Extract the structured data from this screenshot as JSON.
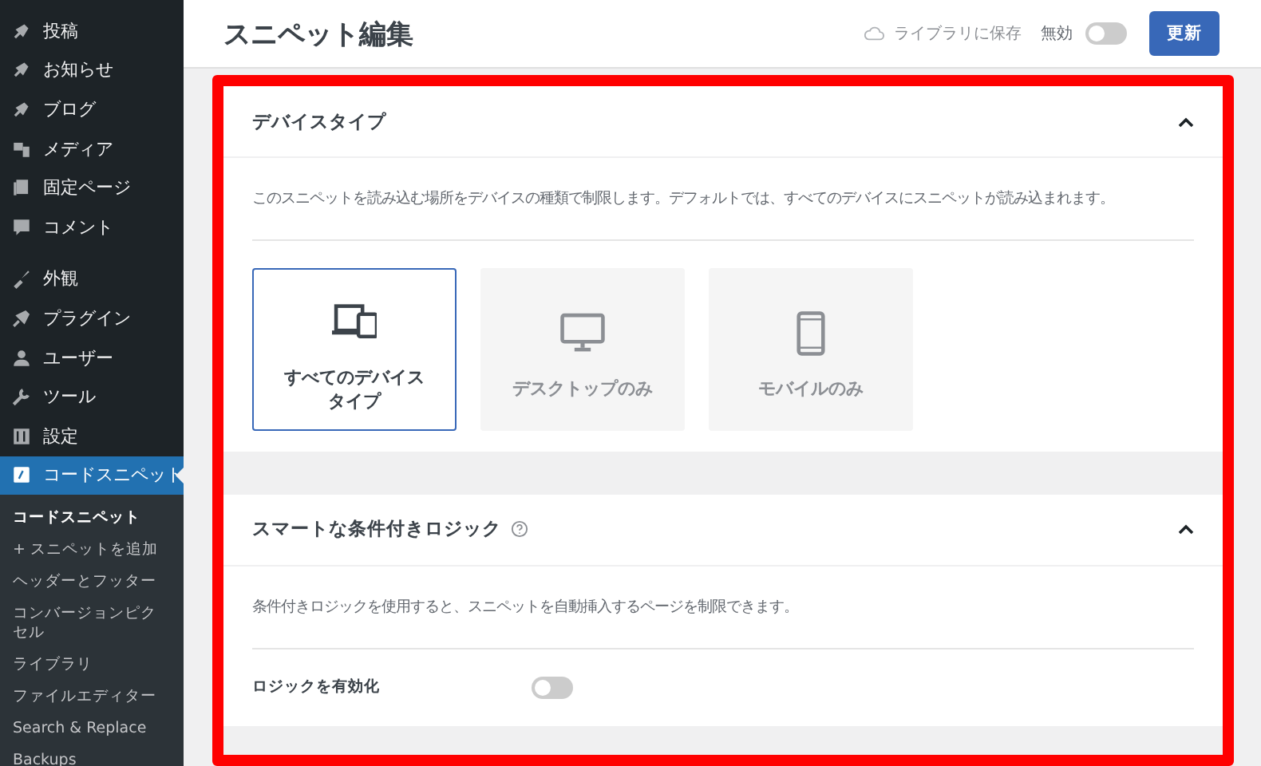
{
  "sidebar": {
    "items": [
      {
        "label": "投稿",
        "selected": false
      },
      {
        "label": "お知らせ",
        "selected": false
      },
      {
        "label": "ブログ",
        "selected": false
      },
      {
        "label": "メディア",
        "selected": false
      },
      {
        "label": "固定ページ",
        "selected": false
      },
      {
        "label": "コメント",
        "selected": false
      },
      {
        "label": "外観",
        "selected": false
      },
      {
        "label": "プラグイン",
        "selected": false
      },
      {
        "label": "ユーザー",
        "selected": false
      },
      {
        "label": "ツール",
        "selected": false
      },
      {
        "label": "設定",
        "selected": false
      },
      {
        "label": "コードスニペット",
        "selected": true
      }
    ],
    "submenu": [
      {
        "label": "コードスニペット",
        "selected": true
      },
      {
        "label": "+ スニペットを追加",
        "selected": false
      },
      {
        "label": "ヘッダーとフッター",
        "selected": false
      },
      {
        "label": "コンバージョンピクセル",
        "selected": false
      },
      {
        "label": "ライブラリ",
        "selected": false
      },
      {
        "label": "ファイルエディター",
        "selected": false
      },
      {
        "label": "Search & Replace",
        "selected": false
      },
      {
        "label": "Backups",
        "selected": false
      }
    ]
  },
  "header": {
    "title": "スニペット編集",
    "save_to_library": "ライブラリに保存",
    "status_label": "無効",
    "active_toggle": {
      "on": false
    },
    "update_button": "更新"
  },
  "panel": {
    "highlighted": true,
    "sections": [
      {
        "kind": "device",
        "title": "デバイスタイプ",
        "expanded": true,
        "description": "このスニペットを読み込む場所をデバイスの種類で制限します。デフォルトでは、すべてのデバイスにスニペットが読み込まれます。",
        "options": [
          {
            "label": "すべてのデバイスタイプ",
            "selected": true
          },
          {
            "label": "デスクトップのみ",
            "selected": false
          },
          {
            "label": "モバイルのみ",
            "selected": false
          }
        ]
      },
      {
        "kind": "logic",
        "title": "スマートな条件付きロジック",
        "expanded": true,
        "description": "条件付きロジックを使用すると、スニペットを自動挿入するページを制限できます。",
        "toggle_label": "ロジックを有効化",
        "toggle": {
          "on": false
        }
      }
    ]
  }
}
